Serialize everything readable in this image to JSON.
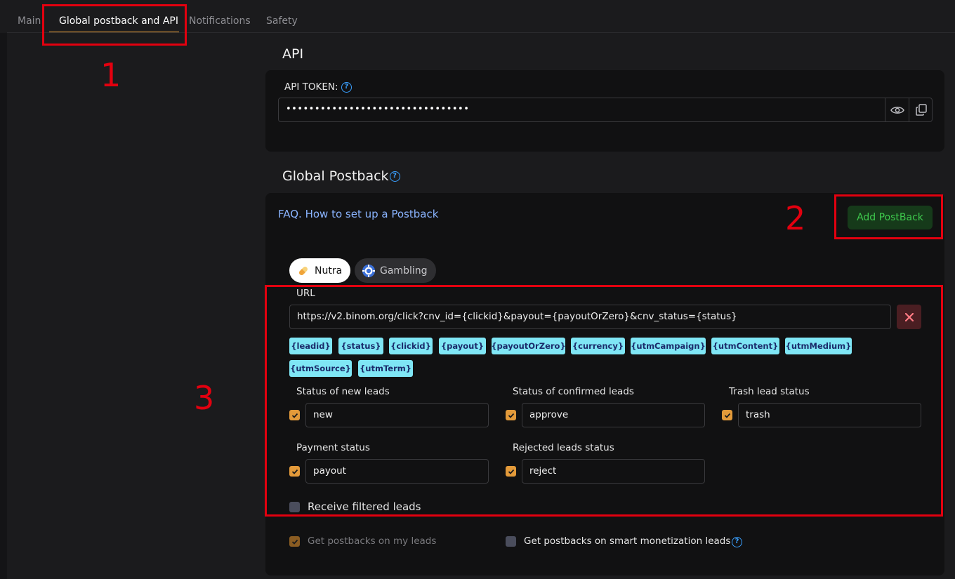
{
  "tabs": [
    {
      "label": "Main",
      "active": false
    },
    {
      "label": "Global postback and API",
      "active": true
    },
    {
      "label": "Notifications",
      "active": false
    },
    {
      "label": "Safety",
      "active": false
    }
  ],
  "api": {
    "title": "API",
    "token_label": "API TOKEN:",
    "token_value": "••••••••••••••••••••••••••••••••",
    "help_glyph": "?"
  },
  "postback": {
    "title": "Global Postback",
    "help_glyph": "?",
    "faq_link": "FAQ. How to set up a Postback",
    "add_button": "Add PostBack",
    "verticals": [
      {
        "label": "Nutra",
        "active": true,
        "icon": "pill-icon"
      },
      {
        "label": "Gambling",
        "active": false,
        "icon": "casino-chip-icon"
      }
    ],
    "url_label": "URL",
    "url_value": "https://v2.binom.org/click?cnv_id={clickid}&payout={payoutOrZero}&cnv_status={status}",
    "macros": [
      "{leadid}",
      "{status}",
      "{clickid}",
      "{payout}",
      "{payoutOrZero}",
      "{currency}",
      "{utmCampaign}",
      "{utmContent}",
      "{utmMedium}",
      "{utmSource}",
      "{utmTerm}"
    ],
    "statuses": {
      "new": {
        "label": "Status of new leads",
        "value": "new",
        "checked": true
      },
      "confirmed": {
        "label": "Status of confirmed leads",
        "value": "approve",
        "checked": true
      },
      "trash": {
        "label": "Trash lead status",
        "value": "trash",
        "checked": true
      },
      "payment": {
        "label": "Payment status",
        "value": "payout",
        "checked": true
      },
      "rejected": {
        "label": "Rejected leads status",
        "value": "reject",
        "checked": true
      }
    },
    "receive_filtered": {
      "label": "Receive filtered leads",
      "checked": false
    },
    "my_leads": {
      "label": "Get postbacks on my leads",
      "checked": true,
      "disabled": true
    },
    "smart_leads": {
      "label": "Get postbacks on smart monetization leads",
      "checked": false
    }
  },
  "annotations": [
    "1",
    "2",
    "3"
  ],
  "colors": {
    "accent": "#f0a43a",
    "annotation": "#e3000f",
    "chip": "#7fe6f5",
    "add_button_text": "#3ec94d"
  }
}
